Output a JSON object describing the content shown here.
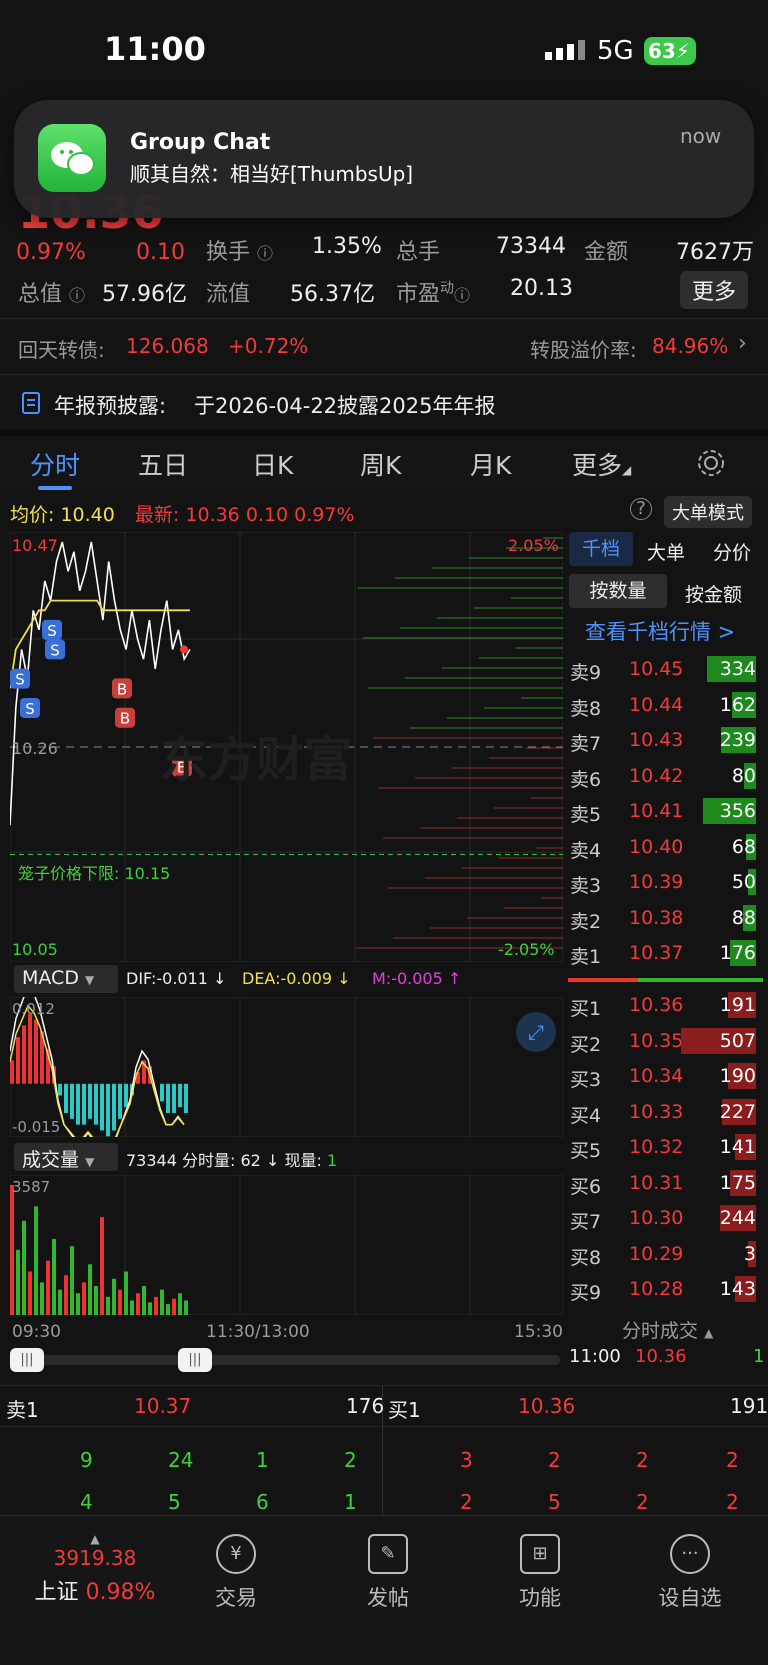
{
  "status": {
    "time": "11:00",
    "network": "5G",
    "battery": "63"
  },
  "notification": {
    "app": "wechat-icon",
    "title": "Group Chat",
    "message": "顺其自然：相当好[ThumbsUp]",
    "time": "now"
  },
  "quote": {
    "price": "10.36",
    "change_pct": "0.97%",
    "change": "0.10",
    "turnover_label": "换手",
    "turnover": "1.35%",
    "total_hands_label": "总手",
    "total_hands": "73344",
    "amount_label": "金额",
    "amount": "7627万",
    "mktcap_label": "总值",
    "mktcap": "57.96亿",
    "float_label": "流值",
    "float": "56.37亿",
    "pe_label": "市盈",
    "pe_sup": "动",
    "pe": "20.13",
    "more_button": "更多"
  },
  "convertible": {
    "label": "回天转债:",
    "price": "126.068",
    "change": "+0.72%",
    "premium_label": "转股溢价率:",
    "premium": "84.96%"
  },
  "announcement": {
    "label": "年报预披露:",
    "text": "于2026-04-22披露2025年年报"
  },
  "tabs": [
    "分时",
    "五日",
    "日K",
    "周K",
    "月K",
    "更多"
  ],
  "chart_info": {
    "avg_label": "均价:",
    "avg": "10.40",
    "latest_label": "最新:",
    "latest": "10.36",
    "change": "0.10",
    "change_pct": "0.97%",
    "mode_button": "大单模式"
  },
  "chart_data": [
    {
      "type": "line",
      "title": "",
      "ylim": [
        10.05,
        10.47
      ],
      "y_ticks_left": [
        "10.47",
        "10.26",
        "10.05"
      ],
      "y_ticks_right": [
        "2.05%",
        "-2.05%"
      ],
      "x_ticks": [
        "09:30",
        "11:30/13:00",
        "15:30"
      ],
      "reference_line": {
        "label": "10.26"
      },
      "limit_line": {
        "label": "笼子价格下限:",
        "value": "10.15"
      },
      "watermark": "东方财富",
      "series": [
        {
          "name": "",
          "color": "#ffffff",
          "values": [
            10.18,
            10.3,
            10.36,
            10.33,
            10.4,
            10.38,
            10.43,
            10.41,
            10.45,
            10.47,
            10.44,
            10.46,
            10.42,
            10.44,
            10.47,
            10.43,
            10.39,
            10.45,
            10.41,
            10.38,
            10.36,
            10.4,
            10.37,
            10.35,
            10.39,
            10.34,
            10.38,
            10.41,
            10.36,
            10.38,
            10.35,
            10.36
          ]
        },
        {
          "name": "",
          "color": "#f0e04b",
          "values": [
            10.32,
            10.36,
            10.37,
            10.38,
            10.39,
            10.4,
            10.4,
            10.41,
            10.41,
            10.41,
            10.41,
            10.41,
            10.41,
            10.41,
            10.41,
            10.41,
            10.4,
            10.4,
            10.4,
            10.4,
            10.4,
            10.4,
            10.4,
            10.4,
            10.4,
            10.4,
            10.4,
            10.4,
            10.4,
            10.4,
            10.4,
            10.4
          ]
        }
      ]
    },
    {
      "type": "bar",
      "title": "MACD",
      "legend": {
        "dif": "DIF:-0.011 ↓",
        "dea": "DEA:-0.009 ↓",
        "m": "M:-0.005 ↑"
      },
      "y_ticks": [
        "0.012",
        "-0.015"
      ],
      "values": [
        0.004,
        0.008,
        0.01,
        0.012,
        0.011,
        0.009,
        0.006,
        0.003,
        -0.002,
        -0.005,
        -0.006,
        -0.007,
        -0.007,
        -0.006,
        -0.007,
        -0.008,
        -0.009,
        -0.008,
        -0.006,
        -0.004,
        -0.002,
        0.002,
        0.004,
        0.003,
        0.0,
        -0.003,
        -0.005,
        -0.005,
        -0.004,
        -0.005
      ]
    },
    {
      "type": "bar",
      "title": "成交量",
      "legend": {
        "total": "73344",
        "per_min_label": "分时量:",
        "per_min": "62 ↓",
        "now_label": "现量:",
        "now": "1"
      },
      "y_ticks": [
        "3587"
      ],
      "values": [
        3587,
        1800,
        2600,
        1200,
        3000,
        900,
        1500,
        2100,
        700,
        1100,
        1900,
        600,
        900,
        1400,
        800,
        2700,
        500,
        1000,
        700,
        1200,
        400,
        600,
        800,
        350,
        500,
        700,
        300,
        450,
        600,
        400
      ]
    }
  ],
  "orderbook": {
    "tabs": [
      "千档",
      "大单",
      "分价"
    ],
    "sub_tabs": [
      "按数量",
      "按金额"
    ],
    "link": "查看千档行情 >",
    "asks": [
      {
        "label": "卖9",
        "price": "10.45",
        "vol": "334"
      },
      {
        "label": "卖8",
        "price": "10.44",
        "vol": "162"
      },
      {
        "label": "卖7",
        "price": "10.43",
        "vol": "239"
      },
      {
        "label": "卖6",
        "price": "10.42",
        "vol": "80"
      },
      {
        "label": "卖5",
        "price": "10.41",
        "vol": "356"
      },
      {
        "label": "卖4",
        "price": "10.40",
        "vol": "68"
      },
      {
        "label": "卖3",
        "price": "10.39",
        "vol": "50"
      },
      {
        "label": "卖2",
        "price": "10.38",
        "vol": "88"
      },
      {
        "label": "卖1",
        "price": "10.37",
        "vol": "176"
      }
    ],
    "bids": [
      {
        "label": "买1",
        "price": "10.36",
        "vol": "191"
      },
      {
        "label": "买2",
        "price": "10.35",
        "vol": "507"
      },
      {
        "label": "买3",
        "price": "10.34",
        "vol": "190"
      },
      {
        "label": "买4",
        "price": "10.33",
        "vol": "227"
      },
      {
        "label": "买5",
        "price": "10.32",
        "vol": "141"
      },
      {
        "label": "买6",
        "price": "10.31",
        "vol": "175"
      },
      {
        "label": "买7",
        "price": "10.30",
        "vol": "244"
      },
      {
        "label": "买8",
        "price": "10.29",
        "vol": "3"
      },
      {
        "label": "买9",
        "price": "10.28",
        "vol": "143"
      }
    ],
    "trades_label": "分时成交",
    "last_trade": {
      "time": "11:00",
      "price": "10.36",
      "vol": "1"
    }
  },
  "bottom_queue": {
    "sell": {
      "label": "卖1",
      "price": "10.37",
      "vol": "176",
      "row1": [
        "9",
        "24",
        "1",
        "2"
      ],
      "row2": [
        "4",
        "5",
        "6",
        "1"
      ]
    },
    "buy": {
      "label": "买1",
      "price": "10.36",
      "vol": "191",
      "row1": [
        "3",
        "2",
        "2",
        "2"
      ],
      "row2": [
        "2",
        "5",
        "2",
        "2"
      ]
    }
  },
  "nav": {
    "index_value": "3919.38",
    "index_name": "上证",
    "index_change": "0.98%",
    "items": [
      {
        "label": "交易",
        "icon": "trade-icon"
      },
      {
        "label": "发帖",
        "icon": "post-icon"
      },
      {
        "label": "功能",
        "icon": "grid-icon"
      },
      {
        "label": "设自选",
        "icon": "more-icon"
      }
    ]
  }
}
